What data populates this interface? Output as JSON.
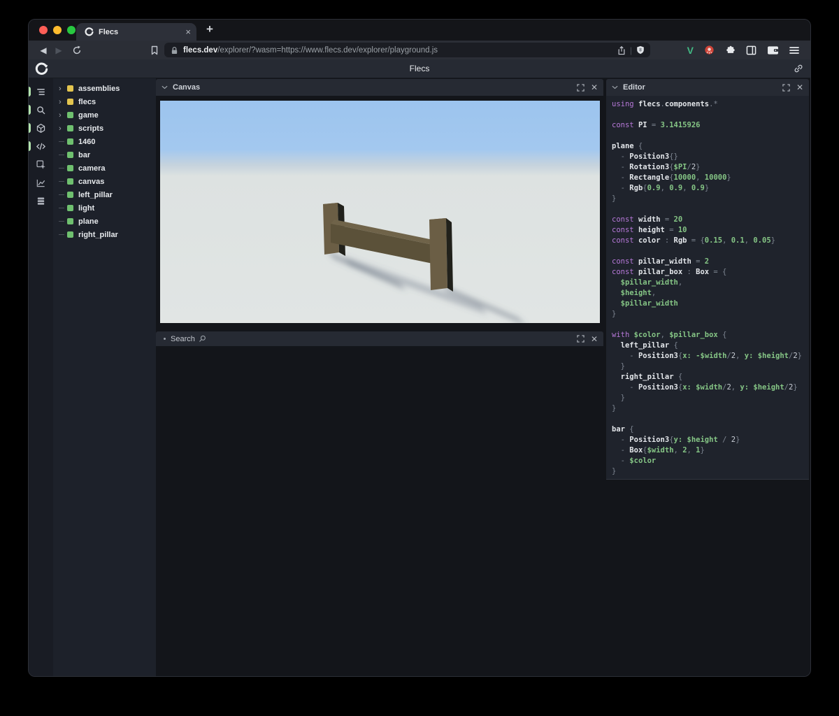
{
  "browser": {
    "traffic_lights": {
      "close": "#ff5f57",
      "minimize": "#febc2e",
      "zoom": "#28c840"
    },
    "tab": {
      "title": "Flecs",
      "close_glyph": "×",
      "new_tab_glyph": "+"
    },
    "nav": {
      "back_glyph": "◀",
      "forward_glyph": "▶"
    },
    "url": {
      "domain": "flecs.dev",
      "rest": "/explorer/?wasm=https://www.flecs.dev/explorer/playground.js"
    }
  },
  "app": {
    "title": "Flecs"
  },
  "rail": {
    "active_color": "#b2e3ac",
    "icons": [
      {
        "name": "tree-view-icon",
        "active": true
      },
      {
        "name": "search-icon",
        "active": true
      },
      {
        "name": "cube-icon",
        "active": true
      },
      {
        "name": "code-icon",
        "active": true
      },
      {
        "name": "inspector-icon",
        "active": false
      },
      {
        "name": "chart-icon",
        "active": false
      },
      {
        "name": "memory-icon",
        "active": false
      }
    ]
  },
  "tree": {
    "items": [
      {
        "label": "assemblies",
        "color": "#e3c54f",
        "expandable": true
      },
      {
        "label": "flecs",
        "color": "#e3c54f",
        "expandable": true
      },
      {
        "label": "game",
        "color": "#6fc06f",
        "expandable": true
      },
      {
        "label": "scripts",
        "color": "#6fc06f",
        "expandable": true
      },
      {
        "label": "1460",
        "color": "#6fc06f",
        "expandable": false
      },
      {
        "label": "bar",
        "color": "#6fc06f",
        "expandable": false
      },
      {
        "label": "camera",
        "color": "#6fc06f",
        "expandable": false
      },
      {
        "label": "canvas",
        "color": "#6fc06f",
        "expandable": false
      },
      {
        "label": "left_pillar",
        "color": "#6fc06f",
        "expandable": false
      },
      {
        "label": "light",
        "color": "#6fc06f",
        "expandable": false
      },
      {
        "label": "plane",
        "color": "#6fc06f",
        "expandable": false
      },
      {
        "label": "right_pillar",
        "color": "#6fc06f",
        "expandable": false
      }
    ]
  },
  "panels": {
    "canvas": {
      "title": "Canvas",
      "close_glyph": "✕"
    },
    "search": {
      "title": "Search",
      "close_glyph": "✕"
    },
    "editor": {
      "title": "Editor",
      "close_glyph": "✕"
    }
  },
  "scene": {
    "sky_top": "#9cc4ee",
    "sky_horizon": "#c6d3dd",
    "ground": "#e1e5e4",
    "pillar_front": "#6b5e45",
    "pillar_side": "#21211b",
    "pillar_top": "#7d7054",
    "bar_front": "#5b5139",
    "bar_top": "#6f6349",
    "shadow": "#5a6575"
  },
  "editor": {
    "lines": [
      [
        [
          "k",
          "using"
        ],
        [
          "w",
          " "
        ],
        [
          "i",
          "flecs"
        ],
        [
          "p",
          "."
        ],
        [
          "i",
          "components"
        ],
        [
          "p",
          ".*"
        ]
      ],
      [],
      [
        [
          "k",
          "const"
        ],
        [
          "w",
          " "
        ],
        [
          "i",
          "PI"
        ],
        [
          "p",
          " = "
        ],
        [
          "n",
          "3.1415926"
        ]
      ],
      [],
      [
        [
          "i",
          "plane"
        ],
        [
          "p",
          " {"
        ]
      ],
      [
        [
          "p",
          "  - "
        ],
        [
          "i",
          "Position3"
        ],
        [
          "p",
          "{}"
        ]
      ],
      [
        [
          "p",
          "  - "
        ],
        [
          "i",
          "Rotation3"
        ],
        [
          "p",
          "{"
        ],
        [
          "v",
          "$PI"
        ],
        [
          "p",
          "/"
        ],
        [
          "w",
          "2"
        ],
        [
          "p",
          "}"
        ]
      ],
      [
        [
          "p",
          "  - "
        ],
        [
          "i",
          "Rectangle"
        ],
        [
          "p",
          "{"
        ],
        [
          "n",
          "10000"
        ],
        [
          "p",
          ", "
        ],
        [
          "n",
          "10000"
        ],
        [
          "p",
          "}"
        ]
      ],
      [
        [
          "p",
          "  - "
        ],
        [
          "i",
          "Rgb"
        ],
        [
          "p",
          "{"
        ],
        [
          "n",
          "0.9"
        ],
        [
          "p",
          ", "
        ],
        [
          "n",
          "0.9"
        ],
        [
          "p",
          ", "
        ],
        [
          "n",
          "0.9"
        ],
        [
          "p",
          "}"
        ]
      ],
      [
        [
          "p",
          "}"
        ]
      ],
      [],
      [
        [
          "k",
          "const"
        ],
        [
          "w",
          " "
        ],
        [
          "i",
          "width"
        ],
        [
          "p",
          " = "
        ],
        [
          "n",
          "20"
        ]
      ],
      [
        [
          "k",
          "const"
        ],
        [
          "w",
          " "
        ],
        [
          "i",
          "height"
        ],
        [
          "p",
          " = "
        ],
        [
          "n",
          "10"
        ]
      ],
      [
        [
          "k",
          "const"
        ],
        [
          "w",
          " "
        ],
        [
          "i",
          "color"
        ],
        [
          "p",
          " : "
        ],
        [
          "i",
          "Rgb"
        ],
        [
          "p",
          " = {"
        ],
        [
          "n",
          "0.15"
        ],
        [
          "p",
          ", "
        ],
        [
          "n",
          "0.1"
        ],
        [
          "p",
          ", "
        ],
        [
          "n",
          "0.05"
        ],
        [
          "p",
          "}"
        ]
      ],
      [],
      [
        [
          "k",
          "const"
        ],
        [
          "w",
          " "
        ],
        [
          "i",
          "pillar_width"
        ],
        [
          "p",
          " = "
        ],
        [
          "n",
          "2"
        ]
      ],
      [
        [
          "k",
          "const"
        ],
        [
          "w",
          " "
        ],
        [
          "i",
          "pillar_box"
        ],
        [
          "p",
          " : "
        ],
        [
          "i",
          "Box"
        ],
        [
          "p",
          " = {"
        ]
      ],
      [
        [
          "w",
          "  "
        ],
        [
          "v",
          "$pillar_width"
        ],
        [
          "p",
          ","
        ]
      ],
      [
        [
          "w",
          "  "
        ],
        [
          "v",
          "$height"
        ],
        [
          "p",
          ","
        ]
      ],
      [
        [
          "w",
          "  "
        ],
        [
          "v",
          "$pillar_width"
        ]
      ],
      [
        [
          "p",
          "}"
        ]
      ],
      [],
      [
        [
          "k",
          "with"
        ],
        [
          "w",
          " "
        ],
        [
          "v",
          "$color"
        ],
        [
          "p",
          ", "
        ],
        [
          "v",
          "$pillar_box"
        ],
        [
          "p",
          " {"
        ]
      ],
      [
        [
          "w",
          "  "
        ],
        [
          "i",
          "left_pillar"
        ],
        [
          "p",
          " {"
        ]
      ],
      [
        [
          "w",
          "    "
        ],
        [
          "p",
          "- "
        ],
        [
          "i",
          "Position3"
        ],
        [
          "p",
          "{"
        ],
        [
          "v",
          "x:"
        ],
        [
          "w",
          " "
        ],
        [
          "v",
          "-$width"
        ],
        [
          "p",
          "/"
        ],
        [
          "w",
          "2"
        ],
        [
          "p",
          ", "
        ],
        [
          "v",
          "y:"
        ],
        [
          "w",
          " "
        ],
        [
          "v",
          "$height"
        ],
        [
          "p",
          "/"
        ],
        [
          "w",
          "2"
        ],
        [
          "p",
          "}"
        ]
      ],
      [
        [
          "w",
          "  "
        ],
        [
          "p",
          "}"
        ]
      ],
      [
        [
          "w",
          "  "
        ],
        [
          "i",
          "right_pillar"
        ],
        [
          "p",
          " {"
        ]
      ],
      [
        [
          "w",
          "    "
        ],
        [
          "p",
          "- "
        ],
        [
          "i",
          "Position3"
        ],
        [
          "p",
          "{"
        ],
        [
          "v",
          "x:"
        ],
        [
          "w",
          " "
        ],
        [
          "v",
          "$width"
        ],
        [
          "p",
          "/"
        ],
        [
          "w",
          "2"
        ],
        [
          "p",
          ", "
        ],
        [
          "v",
          "y:"
        ],
        [
          "w",
          " "
        ],
        [
          "v",
          "$height"
        ],
        [
          "p",
          "/"
        ],
        [
          "w",
          "2"
        ],
        [
          "p",
          "}"
        ]
      ],
      [
        [
          "w",
          "  "
        ],
        [
          "p",
          "}"
        ]
      ],
      [
        [
          "p",
          "}"
        ]
      ],
      [],
      [
        [
          "i",
          "bar"
        ],
        [
          "p",
          " {"
        ]
      ],
      [
        [
          "p",
          "  - "
        ],
        [
          "i",
          "Position3"
        ],
        [
          "p",
          "{"
        ],
        [
          "v",
          "y:"
        ],
        [
          "w",
          " "
        ],
        [
          "v",
          "$height"
        ],
        [
          "p",
          " / "
        ],
        [
          "w",
          "2"
        ],
        [
          "p",
          "}"
        ]
      ],
      [
        [
          "p",
          "  - "
        ],
        [
          "i",
          "Box"
        ],
        [
          "p",
          "{"
        ],
        [
          "v",
          "$width"
        ],
        [
          "p",
          ", "
        ],
        [
          "n",
          "2"
        ],
        [
          "p",
          ", "
        ],
        [
          "n",
          "1"
        ],
        [
          "p",
          "}"
        ]
      ],
      [
        [
          "p",
          "  - "
        ],
        [
          "v",
          "$color"
        ]
      ],
      [
        [
          "p",
          "}"
        ]
      ]
    ]
  }
}
